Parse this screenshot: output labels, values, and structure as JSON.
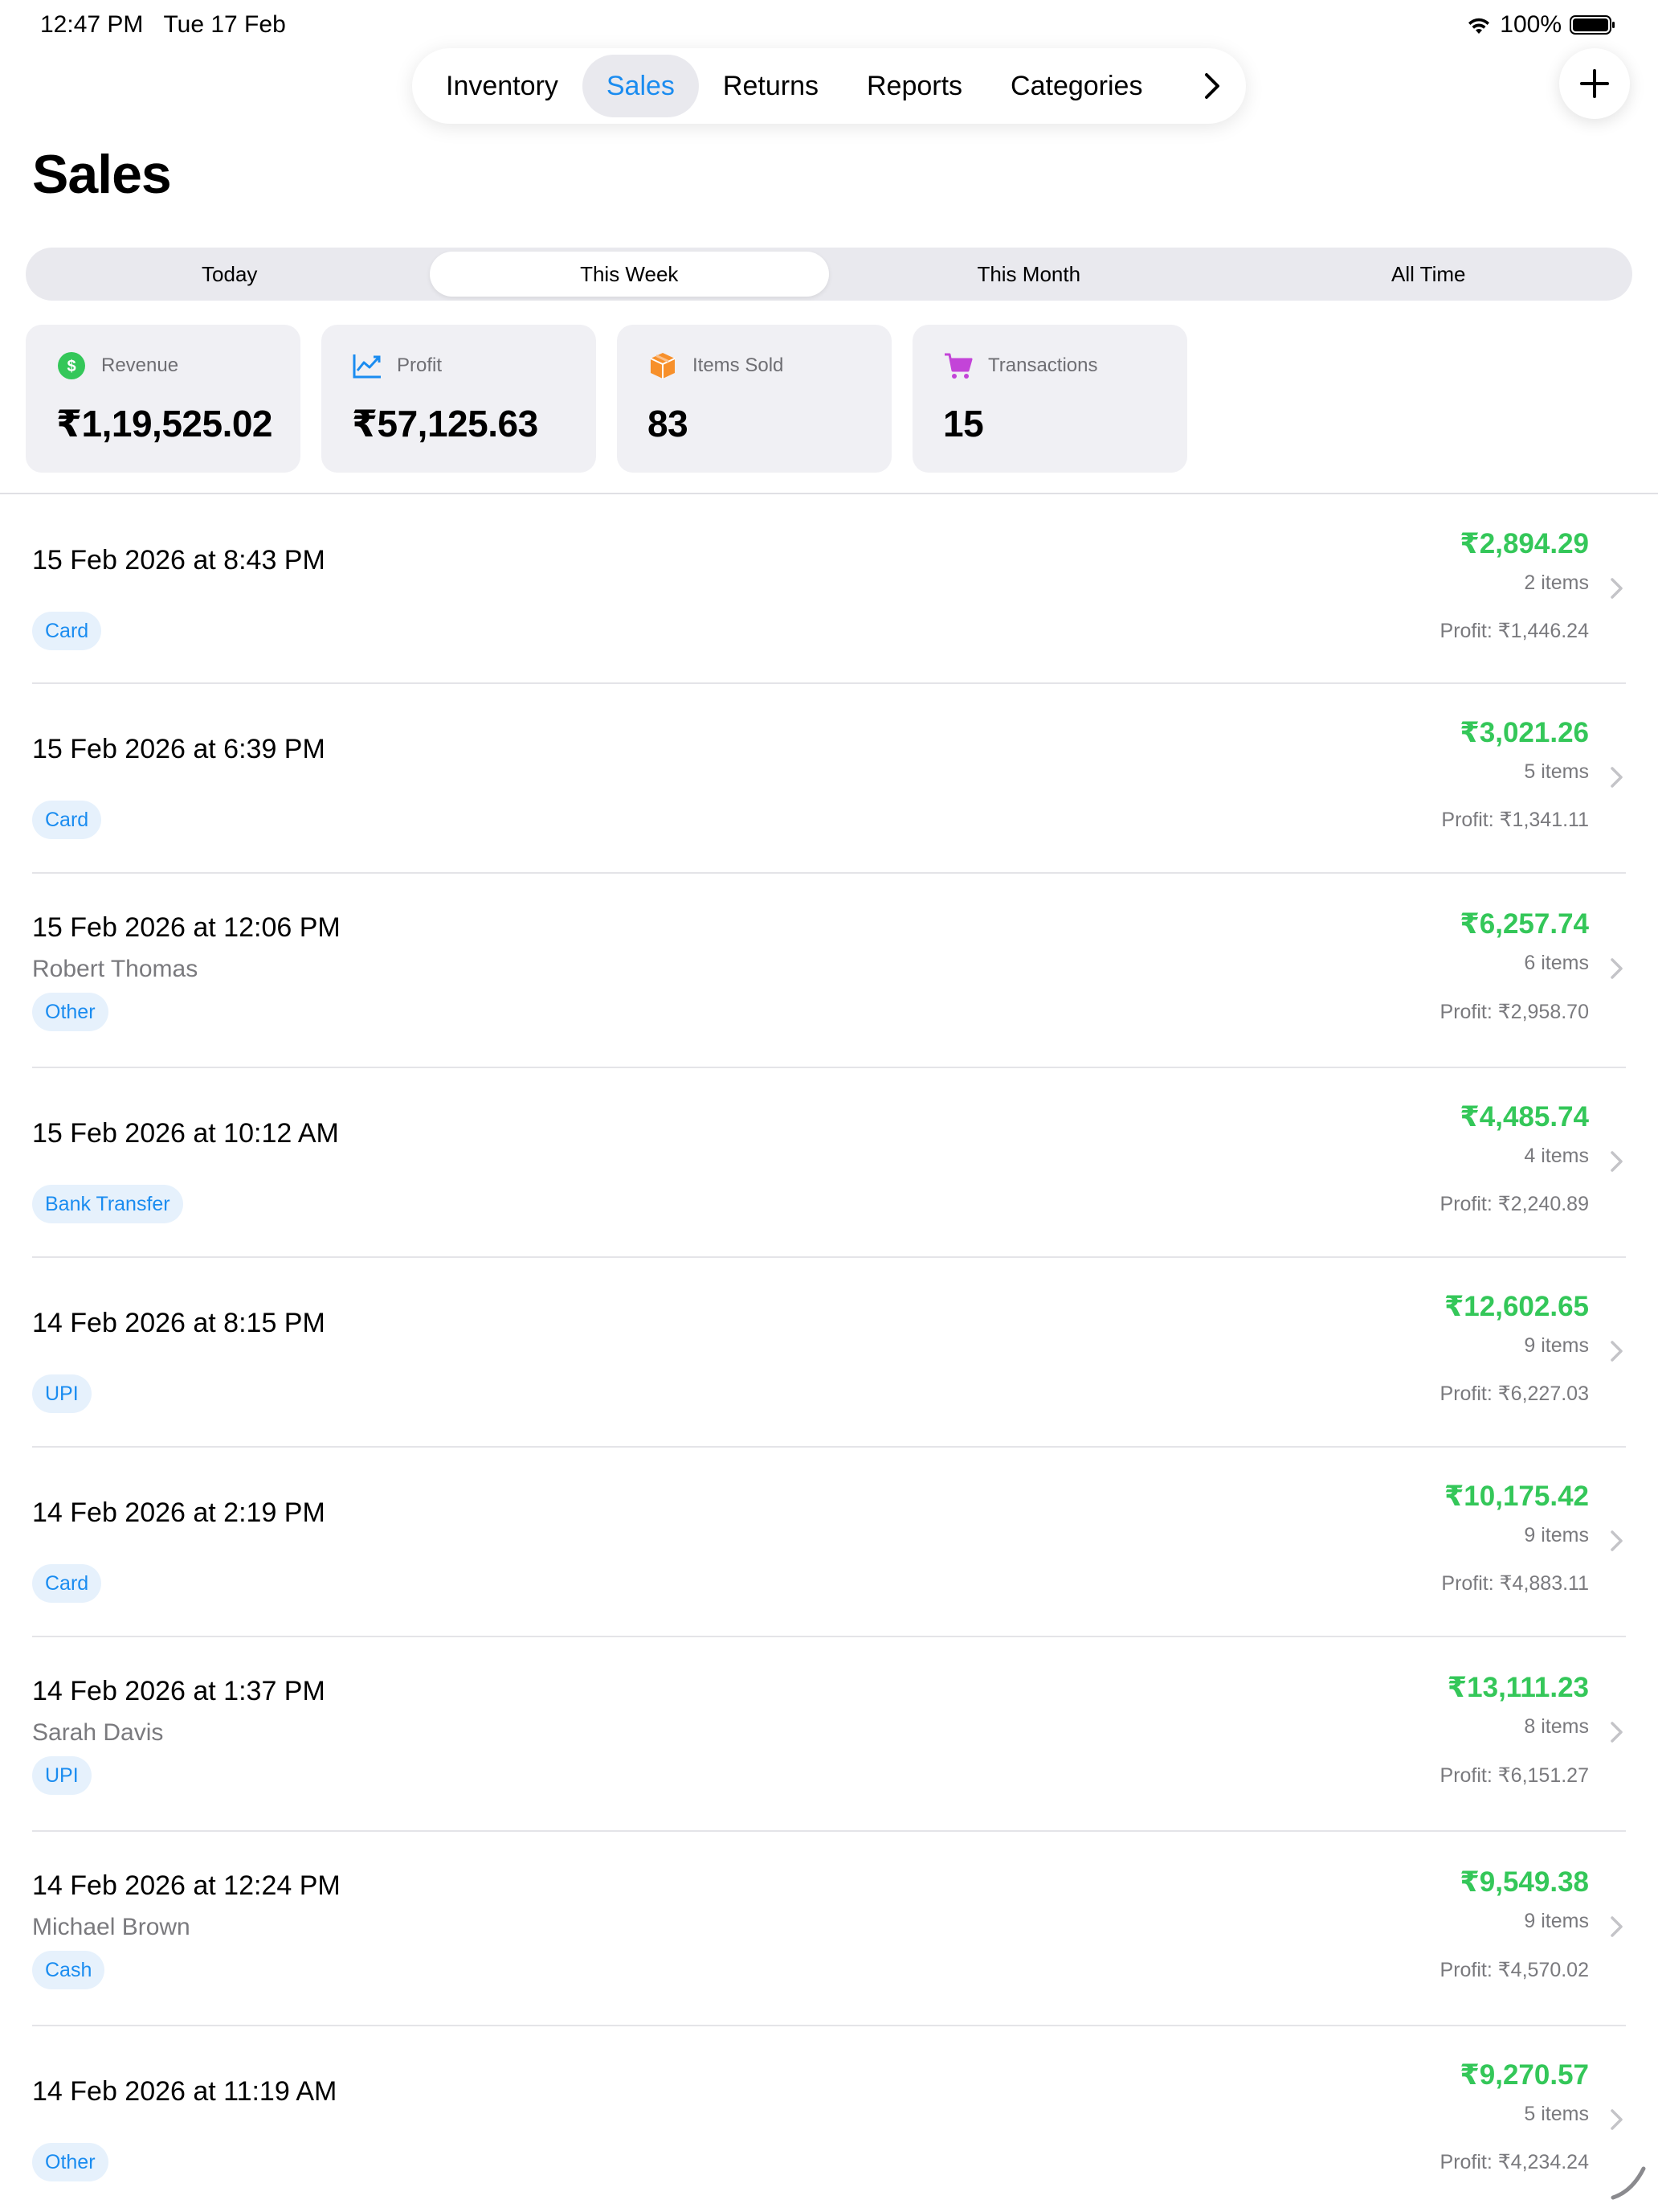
{
  "status": {
    "time": "12:47 PM",
    "date": "Tue 17 Feb",
    "battery": "100%"
  },
  "nav": {
    "tabs": [
      {
        "label": "Inventory"
      },
      {
        "label": "Sales"
      },
      {
        "label": "Returns"
      },
      {
        "label": "Reports"
      },
      {
        "label": "Categories"
      }
    ],
    "active_tab": "Sales"
  },
  "page": {
    "title": "Sales"
  },
  "segments": {
    "items": [
      {
        "label": "Today"
      },
      {
        "label": "This Week"
      },
      {
        "label": "This Month"
      },
      {
        "label": "All Time"
      }
    ],
    "selected": "This Week"
  },
  "stats": [
    {
      "label": "Revenue",
      "value": "₹1,19,525.02",
      "icon": "dollar-circle-icon",
      "color": "#34c759"
    },
    {
      "label": "Profit",
      "value": "₹57,125.63",
      "icon": "trend-chart-icon",
      "color": "#1a8cf0"
    },
    {
      "label": "Items Sold",
      "value": "83",
      "icon": "box-icon",
      "color": "#f7902b"
    },
    {
      "label": "Transactions",
      "value": "15",
      "icon": "cart-icon",
      "color": "#c344d8"
    }
  ],
  "sales": [
    {
      "date": "15 Feb 2026 at 8:43 PM",
      "customer": "",
      "method": "Card",
      "amount": "₹2,894.29",
      "items": "2 items",
      "profit": "Profit: ₹1,446.24"
    },
    {
      "date": "15 Feb 2026 at 6:39 PM",
      "customer": "",
      "method": "Card",
      "amount": "₹3,021.26",
      "items": "5 items",
      "profit": "Profit: ₹1,341.11"
    },
    {
      "date": "15 Feb 2026 at 12:06 PM",
      "customer": "Robert Thomas",
      "method": "Other",
      "amount": "₹6,257.74",
      "items": "6 items",
      "profit": "Profit: ₹2,958.70"
    },
    {
      "date": "15 Feb 2026 at 10:12 AM",
      "customer": "",
      "method": "Bank Transfer",
      "amount": "₹4,485.74",
      "items": "4 items",
      "profit": "Profit: ₹2,240.89"
    },
    {
      "date": "14 Feb 2026 at 8:15 PM",
      "customer": "",
      "method": "UPI",
      "amount": "₹12,602.65",
      "items": "9 items",
      "profit": "Profit: ₹6,227.03"
    },
    {
      "date": "14 Feb 2026 at 2:19 PM",
      "customer": "",
      "method": "Card",
      "amount": "₹10,175.42",
      "items": "9 items",
      "profit": "Profit: ₹4,883.11"
    },
    {
      "date": "14 Feb 2026 at 1:37 PM",
      "customer": "Sarah Davis",
      "method": "UPI",
      "amount": "₹13,111.23",
      "items": "8 items",
      "profit": "Profit: ₹6,151.27"
    },
    {
      "date": "14 Feb 2026 at 12:24 PM",
      "customer": "Michael Brown",
      "method": "Cash",
      "amount": "₹9,549.38",
      "items": "9 items",
      "profit": "Profit: ₹4,570.02"
    },
    {
      "date": "14 Feb 2026 at 11:19 AM",
      "customer": "",
      "method": "Other",
      "amount": "₹9,270.57",
      "items": "5 items",
      "profit": "Profit: ₹4,234.24"
    }
  ]
}
